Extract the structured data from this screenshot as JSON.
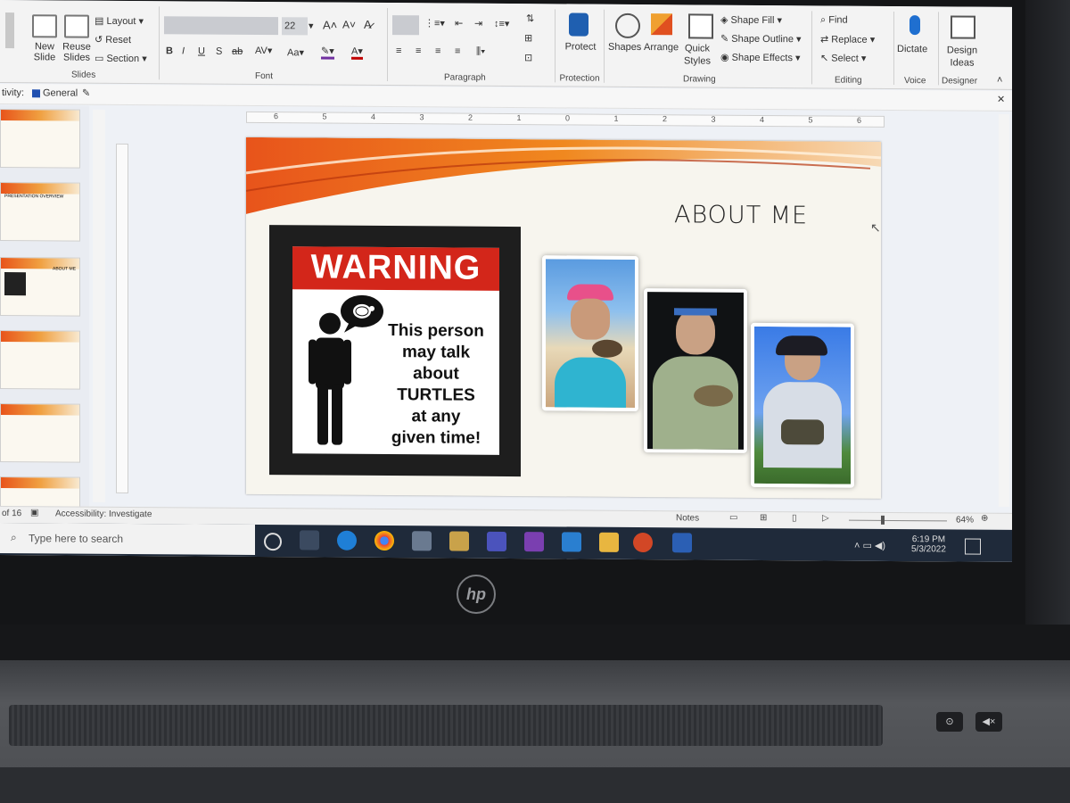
{
  "ribbon": {
    "slides_group": {
      "new_slide": "New Slide",
      "reuse_slides": "Reuse Slides",
      "layout": "Layout",
      "reset": "Reset",
      "section": "Section",
      "label": "Slides"
    },
    "font_group": {
      "font_size": "22",
      "label": "Font"
    },
    "paragraph_group": {
      "label": "Paragraph"
    },
    "protection_group": {
      "protect": "Protect",
      "label": "Protection"
    },
    "drawing_group": {
      "shapes": "Shapes",
      "arrange": "Arrange",
      "quick_styles": "Quick Styles",
      "shape_fill": "Shape Fill",
      "shape_outline": "Shape Outline",
      "shape_effects": "Shape Effects",
      "label": "Drawing"
    },
    "editing_group": {
      "find": "Find",
      "replace": "Replace",
      "select": "Select",
      "label": "Editing"
    },
    "voice_group": {
      "dictate": "Dictate",
      "label": "Voice"
    },
    "designer_group": {
      "design_ideas": "Design Ideas",
      "label": "Designer"
    }
  },
  "activity_bar": {
    "prefix": "tivity:",
    "channel": "General"
  },
  "ruler_numbers": [
    "6",
    "5",
    "4",
    "3",
    "2",
    "1",
    "0",
    "1",
    "2",
    "3",
    "4",
    "5",
    "6"
  ],
  "slide": {
    "title": "ABOUT ME",
    "warning_word": "WARNING",
    "warning_lines": [
      "This person",
      "may talk",
      "about",
      "TURTLES",
      "at any",
      "given time!"
    ]
  },
  "thumbnails": {
    "titles": [
      "",
      "PRESENTATION OVERVIEW",
      "ABOUT ME",
      "",
      "",
      ""
    ]
  },
  "status_bar": {
    "slide_info": "of 16",
    "accessibility": "Accessibility: Investigate",
    "notes": "Notes",
    "zoom": "64%"
  },
  "taskbar": {
    "search_placeholder": "Type here to search",
    "time": "6:19 PM",
    "date": "5/3/2022"
  },
  "colors": {
    "warning_red": "#d3261a",
    "accent_orange": "#e8541b",
    "taskbar": "#1f2a3a"
  }
}
